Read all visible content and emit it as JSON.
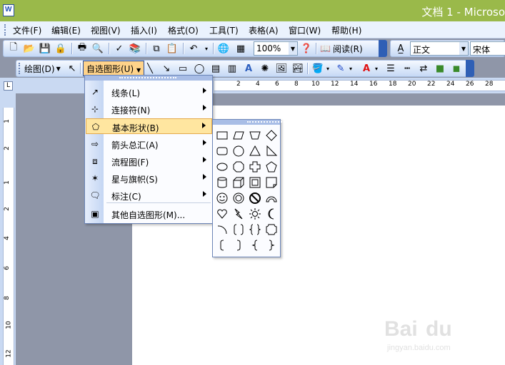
{
  "window": {
    "title": "文档 1 - Microso"
  },
  "menubar": {
    "items": [
      "文件(F)",
      "编辑(E)",
      "视图(V)",
      "插入(I)",
      "格式(O)",
      "工具(T)",
      "表格(A)",
      "窗口(W)",
      "帮助(H)"
    ]
  },
  "toolbar1": {
    "zoom": "100%",
    "read_label": "阅读(R)",
    "style": "正文",
    "font": "宋体"
  },
  "toolbar2": {
    "draw_label": "绘图(D)",
    "autoshapes_label": "自选图形(U)"
  },
  "ruler": {
    "h_numbers": [
      "2",
      "4",
      "6",
      "8",
      "10",
      "12",
      "14",
      "16",
      "18",
      "20",
      "22",
      "24",
      "26",
      "28"
    ],
    "v_numbers": [
      "1",
      "2",
      "1",
      "2",
      "4",
      "6",
      "8",
      "10",
      "12"
    ]
  },
  "autoshapes_menu": {
    "items": [
      {
        "label": "线条(L)",
        "icon": "lines-icon",
        "submenu": true
      },
      {
        "label": "连接符(N)",
        "icon": "connector-icon",
        "submenu": true
      },
      {
        "label": "基本形状(B)",
        "icon": "basic-shapes-icon",
        "submenu": true,
        "highlighted": true
      },
      {
        "label": "箭头总汇(A)",
        "icon": "block-arrows-icon",
        "submenu": true
      },
      {
        "label": "流程图(F)",
        "icon": "flowchart-icon",
        "submenu": true
      },
      {
        "label": "星与旗帜(S)",
        "icon": "stars-banners-icon",
        "submenu": true
      },
      {
        "label": "标注(C)",
        "icon": "callouts-icon",
        "submenu": true
      },
      {
        "label": "其他自选图形(M)...",
        "icon": "more-autoshapes-icon",
        "submenu": false
      }
    ]
  },
  "basic_shapes": [
    "rectangle",
    "parallelogram",
    "trapezoid",
    "diamond",
    "rounded-rectangle",
    "circle",
    "triangle",
    "right-triangle",
    "oval",
    "octagon",
    "cross",
    "pentagon",
    "can",
    "cube",
    "bevel",
    "folded-corner",
    "smiley",
    "donut",
    "no-symbol",
    "block-arc",
    "heart",
    "lightning",
    "sun",
    "moon",
    "arc",
    "double-bracket",
    "double-brace",
    "plaque",
    "left-bracket",
    "right-bracket",
    "left-brace",
    "right-brace"
  ],
  "colors": {
    "title_bar": "#9ab94a",
    "highlight": "#ffe6a0",
    "workspace": "#8f96a8"
  }
}
